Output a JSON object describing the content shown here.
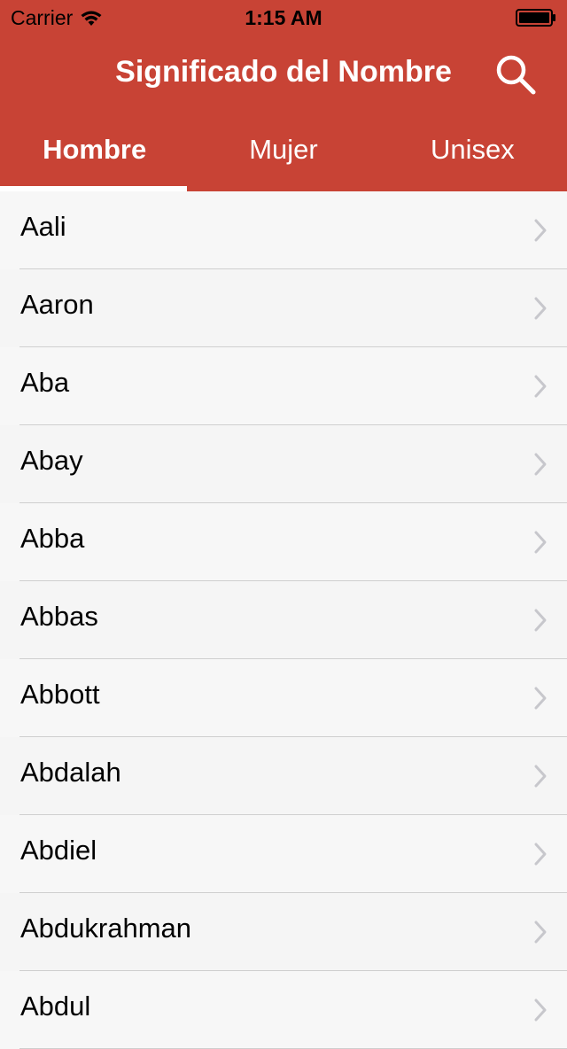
{
  "status_bar": {
    "carrier": "Carrier",
    "time": "1:15 AM",
    "wifi_icon": "wifi-icon",
    "battery_icon": "battery-icon"
  },
  "nav": {
    "title": "Significado del Nombre",
    "search_icon": "search-icon"
  },
  "tabs": [
    {
      "label": "Hombre",
      "active": true
    },
    {
      "label": "Mujer",
      "active": false
    },
    {
      "label": "Unisex",
      "active": false
    }
  ],
  "names": [
    "Aali",
    "Aaron",
    "Aba",
    "Abay",
    "Abba",
    "Abbas",
    "Abbott",
    "Abdalah",
    "Abdiel",
    "Abdukrahman",
    "Abdul"
  ],
  "colors": {
    "header": "#c84335",
    "background": "#f7f7f7",
    "chevron": "#c7c7cc"
  }
}
